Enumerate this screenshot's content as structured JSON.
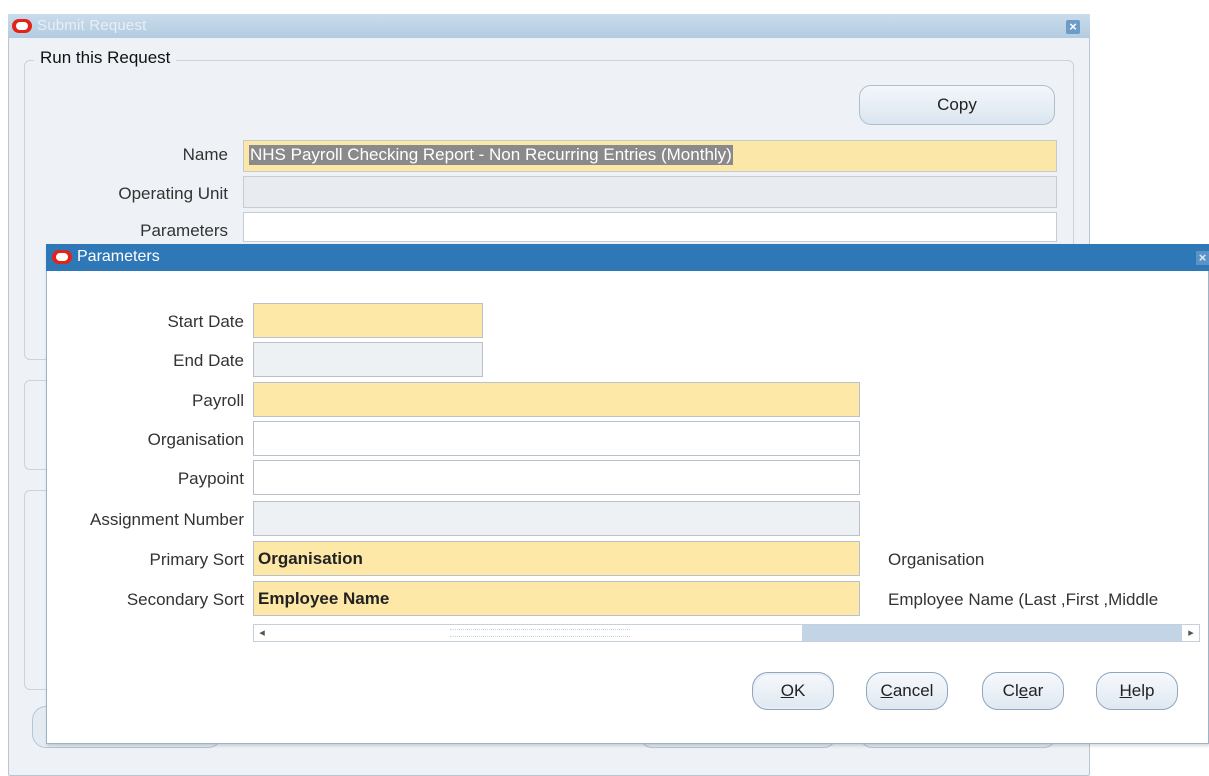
{
  "back_window": {
    "title": "Submit Request",
    "group_label": "Run this Request",
    "copy_label": "Copy",
    "name_label": "Name",
    "name_value": "NHS Payroll Checking Report - Non Recurring Entries (Monthly)",
    "operating_unit_label": "Operating Unit",
    "operating_unit_value": "",
    "parameters_label": "Parameters",
    "parameters_value": ""
  },
  "dialog": {
    "title": "Parameters",
    "fields": [
      {
        "label": "Start Date",
        "value": "",
        "style": "required"
      },
      {
        "label": "End Date",
        "value": "",
        "style": "disabled"
      },
      {
        "label": "Payroll",
        "value": "",
        "style": "required"
      },
      {
        "label": "Organisation",
        "value": "",
        "style": "optional"
      },
      {
        "label": "Paypoint",
        "value": "",
        "style": "optional"
      },
      {
        "label": "Assignment Number",
        "value": "",
        "style": "disabled"
      },
      {
        "label": "Primary Sort",
        "value": "Organisation",
        "style": "required",
        "description": "Organisation"
      },
      {
        "label": "Secondary Sort",
        "value": "Employee Name",
        "style": "required",
        "description": "Employee Name (Last ,First ,Middle"
      }
    ],
    "buttons": {
      "ok": {
        "mnemonic": "O",
        "rest": "K"
      },
      "cancel": {
        "mnemonic": "C",
        "rest": "ancel"
      },
      "clear": {
        "pre": "Cl",
        "mnemonic": "e",
        "rest": "ar"
      },
      "help": {
        "mnemonic": "H",
        "rest": "elp"
      }
    }
  },
  "colors": {
    "required_field": "#fde8a8",
    "disabled_field": "#eef1f4",
    "title_bar": "#2f78b8",
    "oracle_red": "#e2231a"
  },
  "icons": {
    "window_icon": "oracle-logo-icon",
    "close": "close-icon",
    "scroll_left": "scroll-left-arrow-icon",
    "scroll_right": "scroll-right-arrow-icon"
  }
}
